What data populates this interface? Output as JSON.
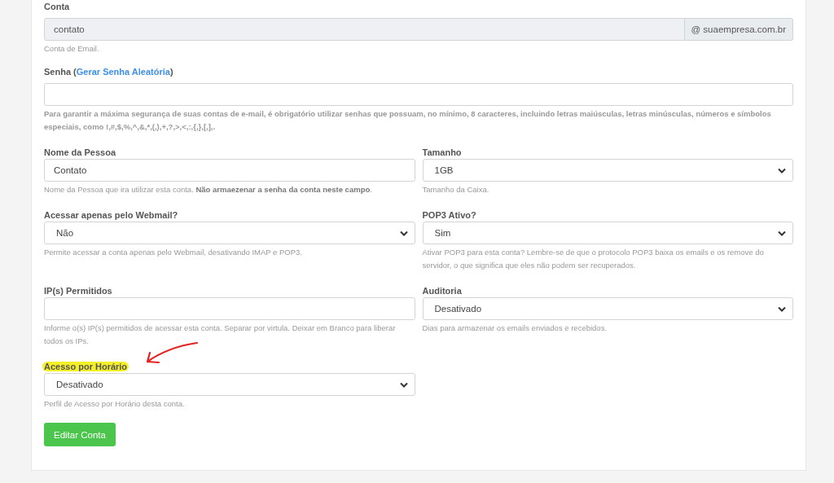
{
  "account": {
    "label": "Conta",
    "value": "contato",
    "suffix": "@ suaempresa.com.br",
    "disabled": true,
    "help": "Conta de Email."
  },
  "password": {
    "label_before": "Senha (",
    "link": "Gerar Senha Aleatória",
    "label_after": ")",
    "help": "Para garantir a máxima segurança de suas contas de e-mail, é obrigatório utilizar senhas que possuam, no mínimo, 8 caracteres, incluindo letras maiúsculas, letras minúsculas, números e símbolos especiais, como !,#,$,%,^,&,*,(,),+,?,>,<,:,{,},[,],."
  },
  "fields": [
    {
      "kind": "text",
      "label": "Nome da Pessoa",
      "value": "Contato",
      "help": "Nome da Pessoa que ira utilizar esta conta. **Não armaezenar a senha da conta neste campo**.",
      "highlighted": false,
      "annotated": false
    },
    {
      "kind": "select",
      "label": "Tamanho",
      "value": "1GB",
      "help": "Tamanho da Caixa.",
      "highlighted": false,
      "annotated": false
    },
    {
      "kind": "select",
      "label": "Acessar apenas pelo Webmail?",
      "value": "Não",
      "help": "Permite acessar a conta apenas pelo Webmail, desativando IMAP e POP3.",
      "highlighted": false,
      "annotated": false
    },
    {
      "kind": "select",
      "label": "POP3 Ativo?",
      "value": "Sim",
      "help": "Ativar POP3 para esta conta? Lembre-se de que o protocolo POP3 baixa os emails e os remove do servidor, o que significa que eles não podem ser recuperados.",
      "highlighted": false,
      "annotated": false
    },
    {
      "kind": "text",
      "label": "IP(s) Permitidos",
      "help": "Informe o(s) IP(s) permitidos de acessar esta conta. Separar por virtula. Deixar em Branco para liberar todos os IPs.",
      "highlighted": false,
      "annotated": false
    },
    {
      "kind": "select",
      "label": "Auditoria",
      "value": "Desativado",
      "help": "Dias para armazenar os emails enviados e recebidos.",
      "highlighted": false,
      "annotated": false
    },
    {
      "kind": "select",
      "label": "Acesso por Horário",
      "value": "Desativado",
      "help": "Perfil de Acesso por Horário desta conta.",
      "highlighted": true,
      "annotated": true
    }
  ],
  "submit": {
    "label": "Editar Conta"
  }
}
